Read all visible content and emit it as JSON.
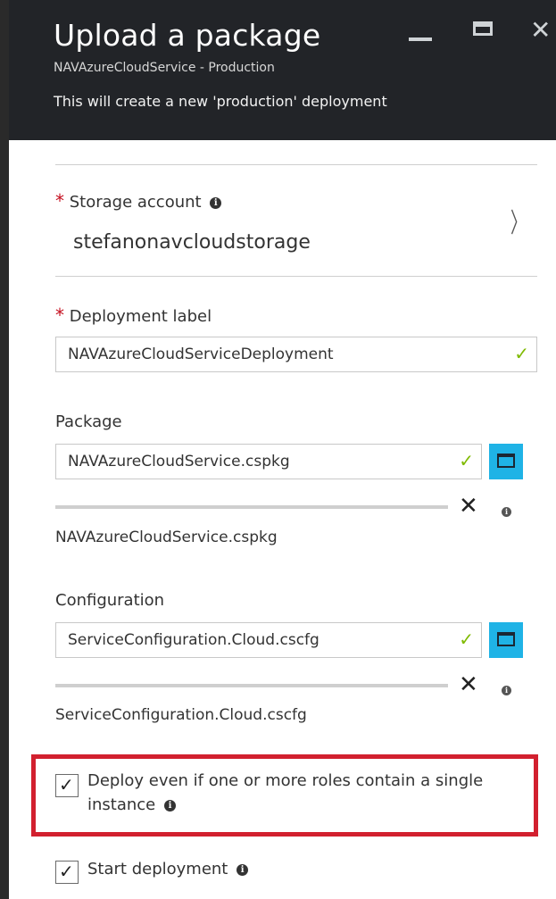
{
  "header": {
    "title": "Upload a package",
    "subtitle": "NAVAzureCloudService - Production",
    "description": "This will create a new 'production' deployment"
  },
  "window_controls": {
    "close": "✕"
  },
  "storage": {
    "required_mark": "*",
    "label": "Storage account",
    "value": "stefanonavcloudstorage"
  },
  "deployment_label": {
    "required_mark": "*",
    "label": "Deployment label",
    "value": "NAVAzureCloudServiceDeployment"
  },
  "package": {
    "label": "Package",
    "value": "NAVAzureCloudService.cspkg",
    "uploaded_file": "NAVAzureCloudService.cspkg"
  },
  "configuration": {
    "label": "Configuration",
    "value": "ServiceConfiguration.Cloud.cscfg",
    "uploaded_file": "ServiceConfiguration.Cloud.cscfg"
  },
  "options": {
    "deploy_single_instance": {
      "label": "Deploy even if one or more roles contain a single instance",
      "checked": true
    },
    "start_deployment": {
      "label": "Start deployment",
      "checked": true
    }
  },
  "glyphs": {
    "check": "✓",
    "info": "i",
    "remove": "✕",
    "chevron": "〉"
  },
  "colors": {
    "header_bg": "#222428",
    "accent_button": "#1fb3e6",
    "valid_check": "#7fba00",
    "required": "#c50f1f",
    "highlight": "#d2202f"
  }
}
